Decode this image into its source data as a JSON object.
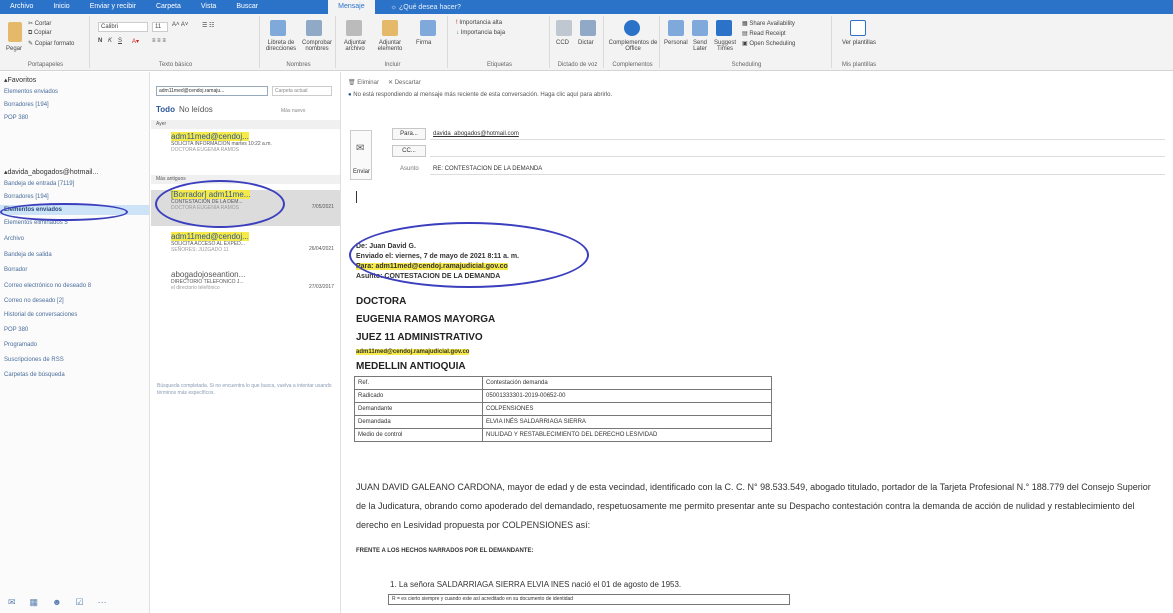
{
  "tabs": [
    "Archivo",
    "Inicio",
    "Enviar y recibir",
    "Carpeta",
    "Vista",
    "Buscar",
    "Mensaje"
  ],
  "active_tab_index": 6,
  "tell_me": "¿Qué desea hacer?",
  "ribbon": {
    "clipboard": {
      "paste": "Pegar",
      "cut": "Cortar",
      "copy": "Copiar",
      "format_painter": "Copiar formato",
      "group": "Portapapeles"
    },
    "font": {
      "name": "Calibri",
      "size": "11",
      "group": "Texto básico"
    },
    "names": {
      "address_book": "Libreta de direcciones",
      "check_names": "Comprobar nombres",
      "group": "Nombres"
    },
    "include": {
      "attach_file": "Adjuntar archivo",
      "attach_item": "Adjuntar elemento",
      "signature": "Firma",
      "group": "Incluir"
    },
    "tags": {
      "high_importance": "Importancia alta",
      "low_importance": "Importancia baja",
      "group": "Etiquetas"
    },
    "dictate": {
      "ccd": "CCD",
      "dictate": "Dictar",
      "group": "Dictado de voz"
    },
    "addins": {
      "office_addins": "Complementos de Office",
      "group": "Complementos"
    },
    "meeting": {
      "personal": "Personal",
      "send_later": "Send Later",
      "suggest_times": "Suggest Times",
      "share_availability": "Share Availability",
      "read_receipt": "Read Receipt",
      "open_scheduling": "Open Scheduling",
      "group": "Scheduling"
    },
    "templates": {
      "view_templates": "Ver plantillas",
      "group": "Mis plantillas"
    }
  },
  "folders": {
    "favorites_header": "Favoritos",
    "favorites": [
      "Elementos enviados",
      "Borradores [194]",
      "POP 380"
    ],
    "account": "davida_abogados@hotmail...",
    "items": [
      "Bandeja de entrada [7119]",
      "Borradores [194]",
      "Elementos enviados",
      "Elementos eliminados 5",
      "Archivo",
      "Bandeja de salida",
      "Borrador",
      "Correo electrónico no deseado 8",
      "Correo no deseado [2]",
      "Historial de conversaciones",
      "POP 380",
      "Programado",
      "Suscripciones de RSS",
      "Carpetas de búsqueda"
    ],
    "selected_index": 2
  },
  "message_list": {
    "search_value": "adm11med@cendoj.ramaju...",
    "search_scope": "Carpeta actual",
    "filter_all": "Todo",
    "filter_unread": "No leídos",
    "sort": "Más nuevo",
    "group_today": "Ayer",
    "group_older": "Más antiguos",
    "items": [
      {
        "sender": "adm11med@cendoj...",
        "subject": "SOLICITA INFORMACION",
        "date": "martes 10:22 a.m.",
        "preview": "DOCTORA EUGENIA RAMOS"
      },
      {
        "sender": "[Borrador] adm11me...",
        "subject": "CONTESTACION DE LA DEM...",
        "date": "7/05/2021",
        "preview": "DOCTORA EUGENIA RAMOS"
      },
      {
        "sender": "adm11med@cendoj...",
        "subject": "SOLICITA ACCESO AL EXPED...",
        "date": "26/04/2021",
        "preview": "SEÑORES: JUZGADO 11"
      },
      {
        "sender": "abogadojoseantion...",
        "subject": "DIRECTORIO TELEFONICO J...",
        "date": "27/03/2017",
        "preview": "el directorio telefónico"
      }
    ],
    "footer_note": "Búsqueda completada. Si no encuentra lo que busca, vuelva a intentar usando términos más específicos."
  },
  "compose": {
    "toolbar_delete": "Eliminar",
    "toolbar_discard": "Descartar",
    "info": "No está respondiendo al mensaje más reciente de esta conversación. Haga clic aquí para abrirlo.",
    "send_label": "Enviar",
    "to_button": "Para...",
    "cc_button": "CC...",
    "to_value": "davida_abogados@hotmail.com",
    "subject_label": "Asunto",
    "subject_value": "RE: CONTESTACION DE LA DEMANDA",
    "header": {
      "from": "De: Juan David G.",
      "sent": "Enviado el: viernes, 7 de mayo de 2021 8:11 a. m.",
      "to": "Para: adm11med@cendoj.ramajudicial.gov.co",
      "subject": "Asunto: CONTESTACION DE LA DEMANDA"
    },
    "body": {
      "line1": "DOCTORA",
      "line2": "EUGENIA RAMOS MAYORGA",
      "line3": "JUEZ 11 ADMINISTRATIVO",
      "email": "adm11med@cendoj.ramajudicial.gov.co",
      "city": "MEDELLIN ANTIOQUIA",
      "table": [
        [
          "Ref.",
          "Contestación demanda"
        ],
        [
          "Radicado",
          "05001333301-2019-00652-00"
        ],
        [
          "Demandante",
          "COLPENSIONES"
        ],
        [
          "Demandada",
          "ELVIA INÉS SALDARRIAGA SIERRA"
        ],
        [
          "Medio de control",
          "NULIDAD Y RESTABLECIMIENTO DEL DERECHO LESIVIDAD"
        ]
      ],
      "paragraph": "JUAN DAVID GALEANO CARDONA, mayor de edad y de esta vecindad, identificado con la C. C. N° 98.533.549, abogado titulado, portador de la Tarjeta Profesional N.° 188.779 del Consejo Superior de la Judicatura, obrando como apoderado del demandado, respetuosamente me permito presentar ante su Despacho contestación contra la demanda de acción de nulidad y restablecimiento del derecho en Lesividad propuesta por COLPENSIONES así:",
      "section": "FRENTE A LOS HECHOS NARRADOS POR EL DEMANDANTE:",
      "item1": "1.   La señora SALDARRIAGA SIERRA ELVIA INES nació el 01 de agosto de 1953.",
      "box1": "R = es cierto siempre y cuando este así acreditado en su documento de identidad"
    }
  },
  "colors": {
    "accent": "#2b73c9",
    "highlight": "#f6e94a",
    "annotation": "#3b3fbd",
    "selected": "#cde3f7"
  }
}
